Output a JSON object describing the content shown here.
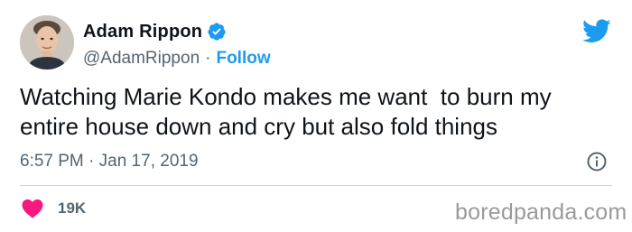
{
  "author": {
    "name": "Adam Rippon",
    "handle": "@AdamRippon",
    "separator": "·",
    "follow_label": "Follow",
    "verified": true
  },
  "tweet": {
    "text": "Watching Marie Kondo makes me want  to burn my\nentire house down and cry but also fold things",
    "timestamp": "6:57 PM · Jan 17, 2019"
  },
  "engagement": {
    "likes": "19K"
  },
  "watermark": "boredpanda.com",
  "icons": {
    "brand": "twitter-bird-icon",
    "verified": "verified-badge-icon",
    "info": "info-icon",
    "like": "heart-icon"
  },
  "colors": {
    "accent": "#1d9bf0",
    "like": "#f91880",
    "secondary_text": "#536471"
  }
}
